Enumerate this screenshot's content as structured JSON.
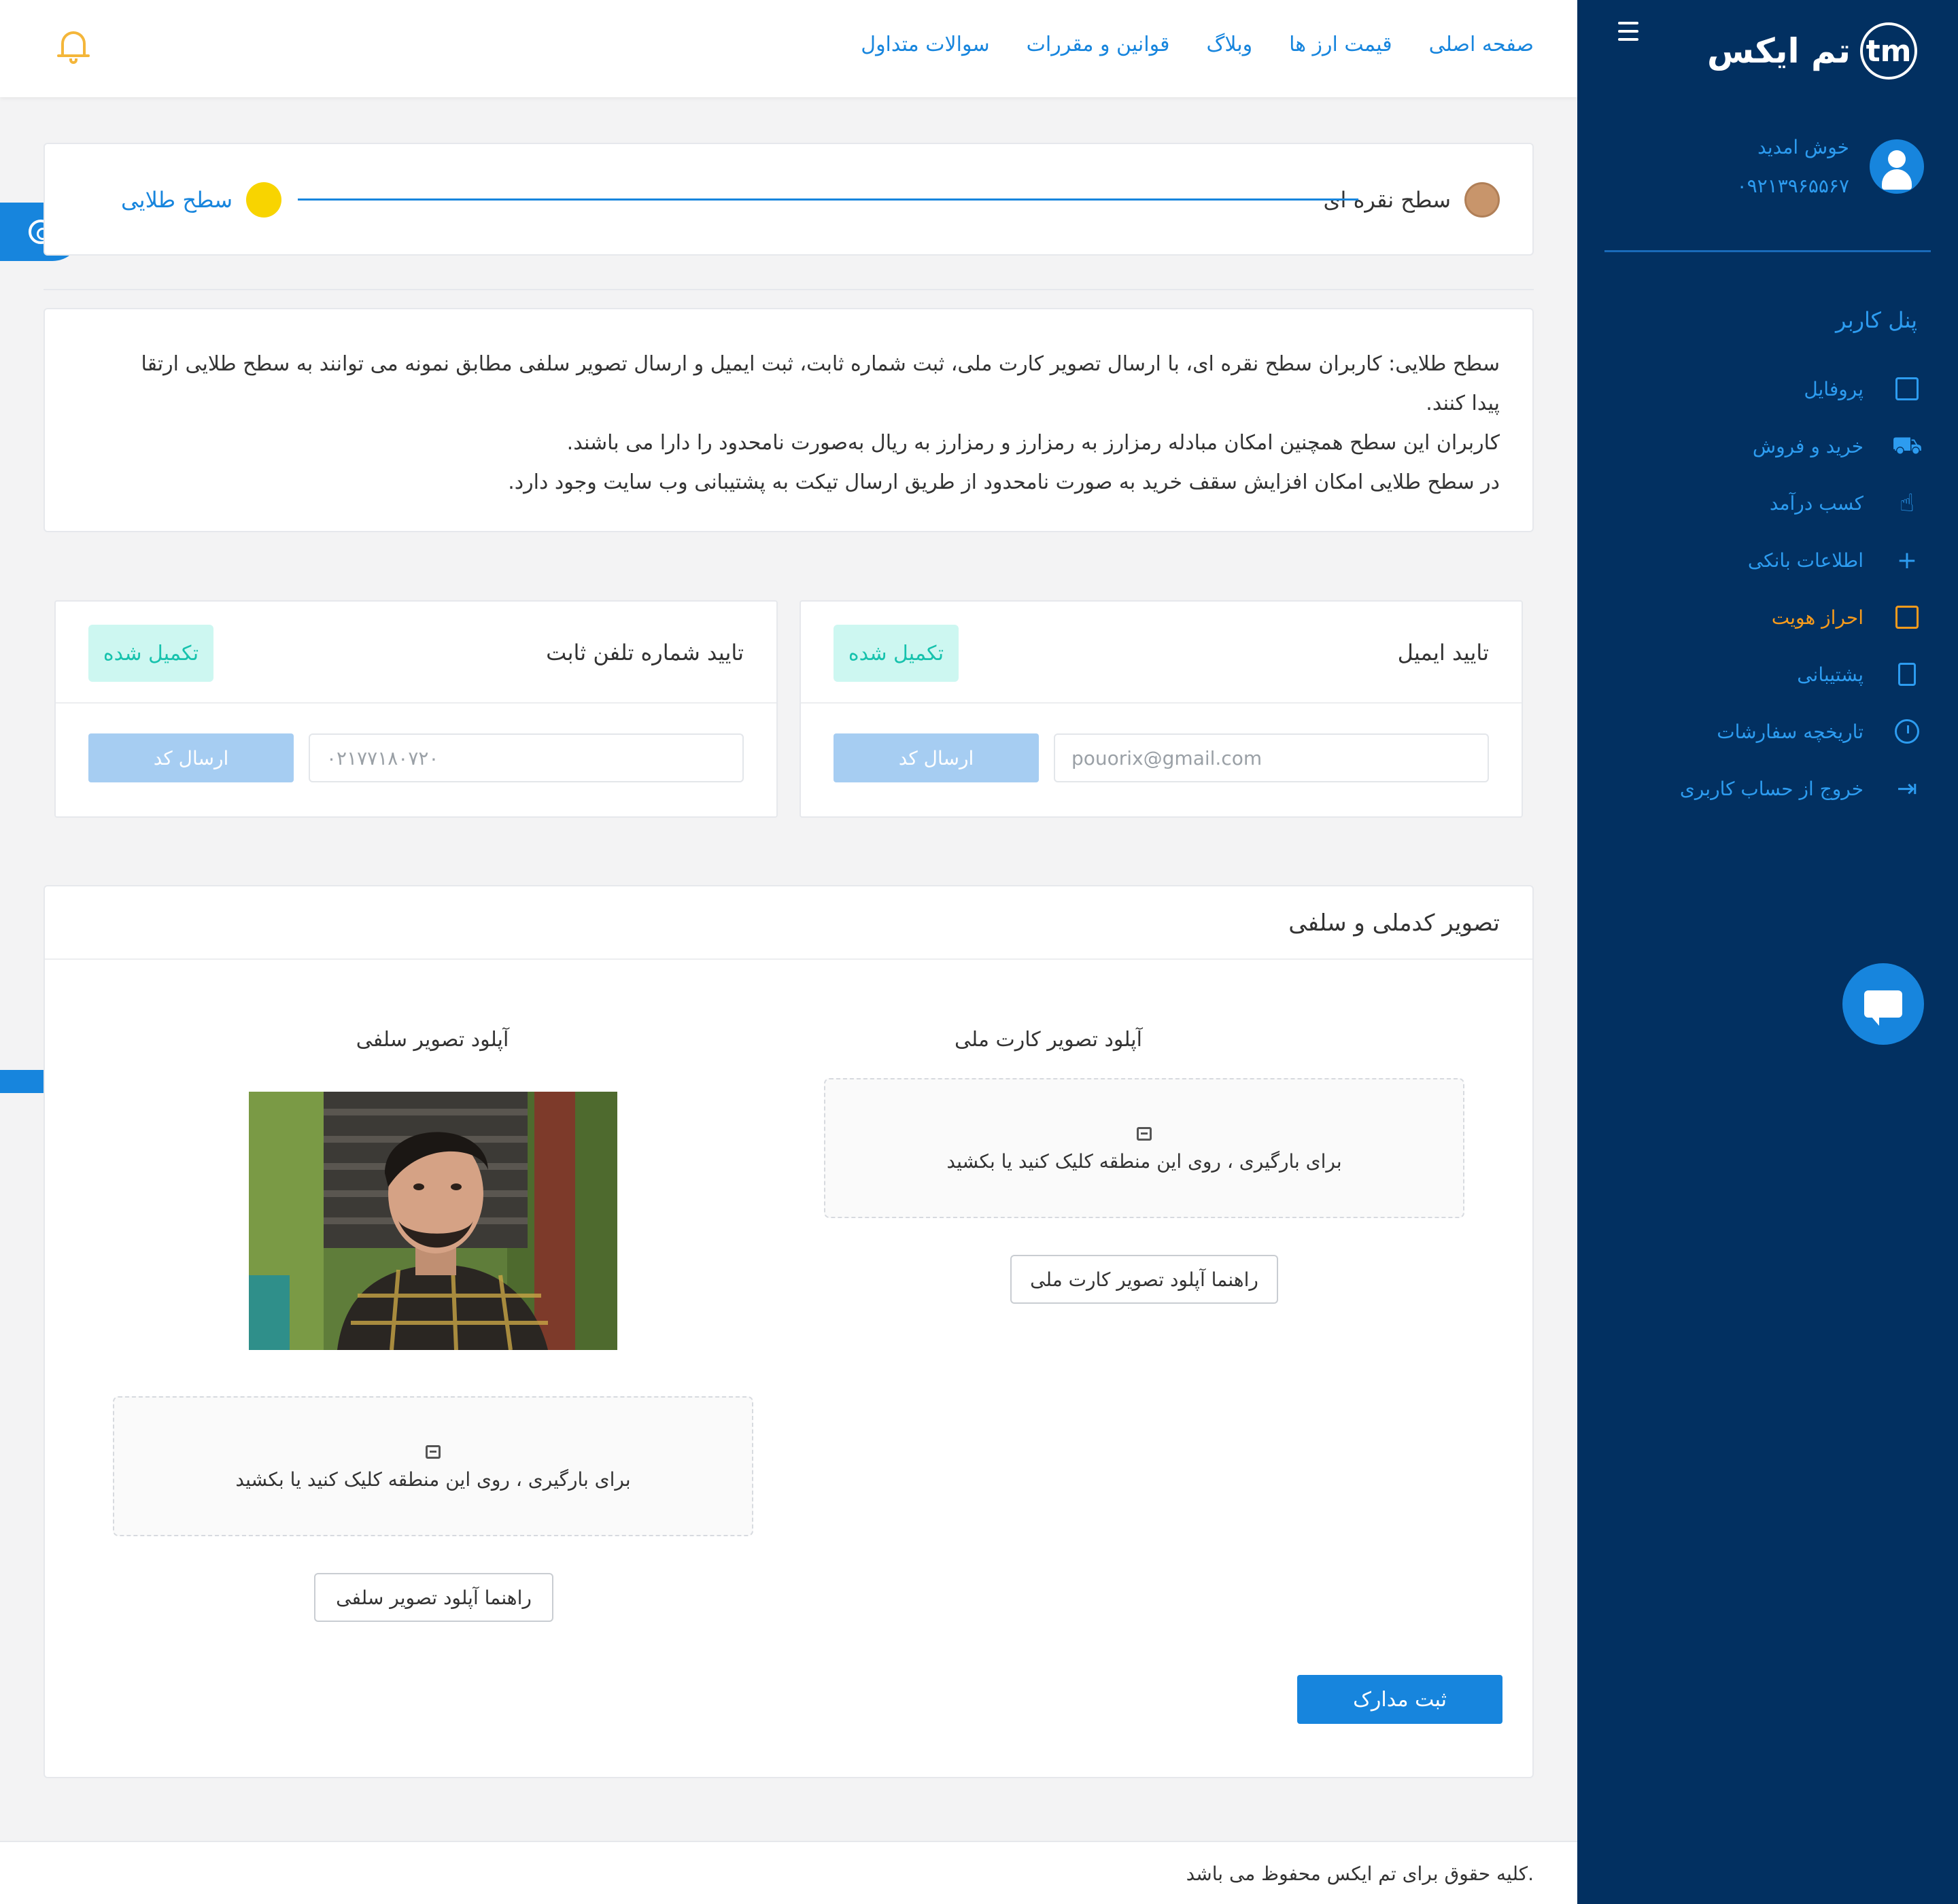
{
  "brand": {
    "logo_text": "tm",
    "name": "تم ایکس"
  },
  "user": {
    "greeting": "خوش امدید",
    "phone": "۰۹۲۱۳۹۶۵۵۶۷"
  },
  "sidebar": {
    "panel_title": "پنل کاربر",
    "items": [
      {
        "label": "پروفایل",
        "icon": "profile-icon"
      },
      {
        "label": "خرید و فروش",
        "icon": "cart-icon"
      },
      {
        "label": "کسب درآمد",
        "icon": "income-icon"
      },
      {
        "label": "اطلاعات بانکی",
        "icon": "plus-icon"
      },
      {
        "label": "احراز هویت",
        "icon": "id-card-icon",
        "active": true
      },
      {
        "label": "پشتیبانی",
        "icon": "support-icon"
      },
      {
        "label": "تاریخچه سفارشات",
        "icon": "clock-icon"
      },
      {
        "label": "خروج از حساب کاربری",
        "icon": "logout-icon"
      }
    ]
  },
  "topnav": {
    "links": [
      "صفحه اصلی",
      "قیمت ارز ها",
      "وبلاگ",
      "قوانین و مقررات",
      "سوالات متداول"
    ]
  },
  "levels": {
    "silver": {
      "label": "سطح نقره ای",
      "color": "#c8956b"
    },
    "gold": {
      "label": "سطح طلایی",
      "color": "#f8d400"
    }
  },
  "info": {
    "lines": [
      "سطح طلایی: کاربران سطح نقره ای، با ارسال تصویر کارت ملی، ثبت شماره ثابت، ثبت ایمیل و ارسال تصویر سلفی مطابق نمونه می توانند به سطح طلایی ارتقا",
      "پیدا کنند.",
      "کاربران این سطح همچنین امکان مبادله رمزارز به رمزارز و رمزارز به ریال به‌صورت نامحدود را دارا می باشند.",
      "در سطح طلایی امکان افزایش سقف خرید به صورت نامحدود از طریق ارسال تیکت به پشتیبانی وب سایت وجود دارد."
    ]
  },
  "verify": {
    "email": {
      "title": "تایید ایمیل",
      "status": "تکمیل شده",
      "value": "pouorix@gmail.com",
      "button": "ارسال کد"
    },
    "phone": {
      "title": "تایید شماره تلفن ثابت",
      "status": "تکمیل شده",
      "value": "۰۲۱۷۷۱۸۰۷۲۰",
      "button": "ارسال کد"
    }
  },
  "documents": {
    "title": "تصویر کدملی و سلفی",
    "national_card": {
      "title": "آپلود تصویر کارت ملی",
      "dropzone": "برای بارگیری ، روی این منطقه کلیک کنید یا بکشید",
      "guide": "راهنما آپلود تصویر کارت ملی"
    },
    "selfie": {
      "title": "آپلود تصویر سلفی",
      "dropzone": "برای بارگیری ، روی این منطقه کلیک کنید یا بکشید",
      "guide": "راهنما آپلود تصویر سلفی"
    },
    "submit": "ثبت مدارک"
  },
  "footer": {
    "text": ".کلیه حقوق برای تم ایکس محفوظ می باشد"
  },
  "colors": {
    "sidebar": "#023061",
    "accent": "#1785dd",
    "active": "#f79b1c",
    "success_bg": "#cdf7f1",
    "success_text": "#17c2ad"
  }
}
